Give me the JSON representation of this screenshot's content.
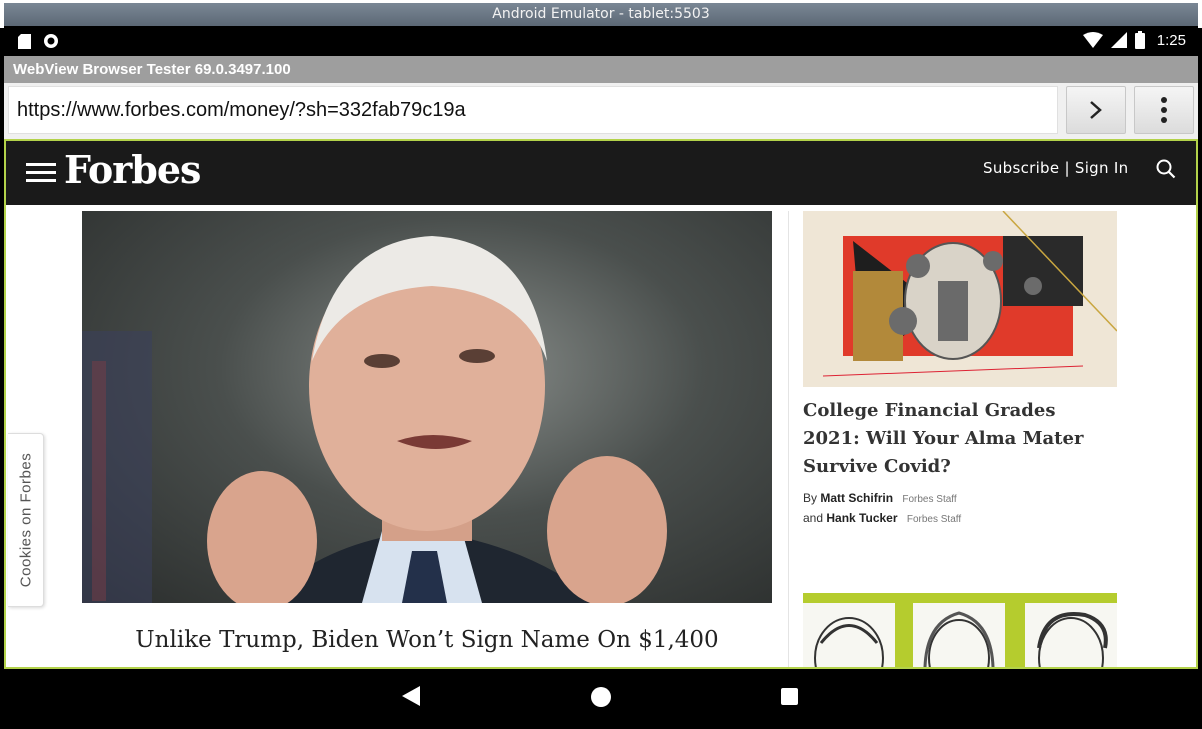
{
  "window": {
    "title": "Android Emulator - tablet:5503"
  },
  "status_bar": {
    "time": "1:25"
  },
  "app": {
    "title": "WebView Browser Tester 69.0.3497.100"
  },
  "url_bar": {
    "url": "https://www.forbes.com/money/?sh=332fab79c19a"
  },
  "site": {
    "logo": "Forbes",
    "subscribe_sign_in": "Subscribe | Sign In"
  },
  "hero": {
    "title": "Unlike Trump, Biden Won’t Sign Name On $1,400"
  },
  "side_story": {
    "title": "College Financial Grades 2021: Will Your Alma Mater Survive Covid?",
    "by_prefix": "By",
    "author1": "Matt Schifrin",
    "author1_role": "Forbes Staff",
    "and_prefix": "and",
    "author2": "Hank Tucker",
    "author2_role": "Forbes Staff"
  },
  "cookies_tab": {
    "label": "Cookies on Forbes"
  },
  "colors": {
    "forbes_header": "#1a1a1a",
    "webview_border": "#b3d24a",
    "accent_green": "#b5cc2e"
  }
}
